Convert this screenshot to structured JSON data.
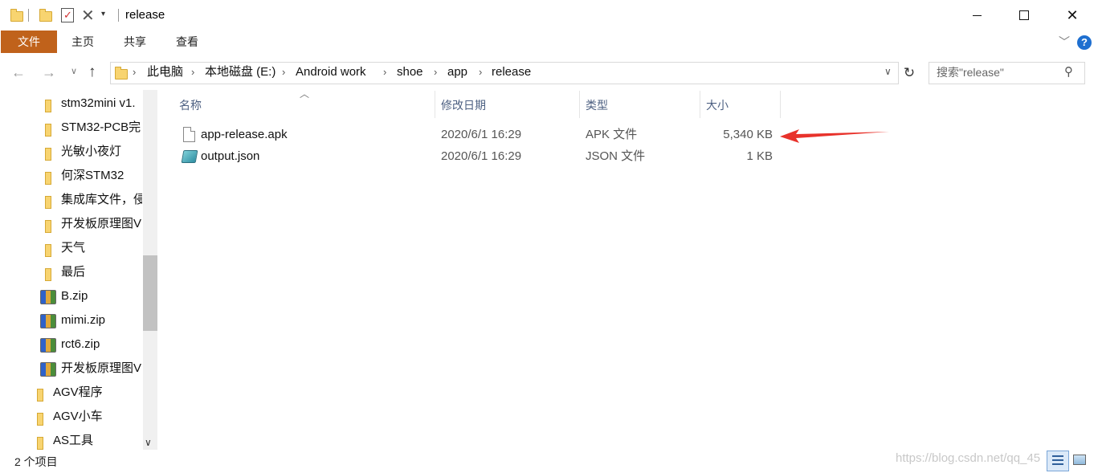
{
  "window": {
    "title": "release"
  },
  "ribbon": {
    "tabs": [
      "文件",
      "主页",
      "共享",
      "查看"
    ]
  },
  "address": {
    "breadcrumbs": [
      "此电脑",
      "本地磁盘 (E:)",
      "Android work",
      "shoe",
      "app",
      "release"
    ]
  },
  "search": {
    "placeholder": "搜索\"release\""
  },
  "nav": {
    "items": [
      {
        "label": "stm32mini v1.",
        "icon": "folder-icon"
      },
      {
        "label": "STM32-PCB完",
        "icon": "folder-icon"
      },
      {
        "label": "光敏小夜灯",
        "icon": "folder-icon"
      },
      {
        "label": "何深STM32",
        "icon": "folder-icon"
      },
      {
        "label": "集成库文件，侵",
        "icon": "folder-icon"
      },
      {
        "label": "开发板原理图V",
        "icon": "folder-icon"
      },
      {
        "label": "天气",
        "icon": "folder-icon"
      },
      {
        "label": "最后",
        "icon": "folder-icon"
      },
      {
        "label": "B.zip",
        "icon": "zip-icon"
      },
      {
        "label": "mimi.zip",
        "icon": "zip-icon"
      },
      {
        "label": "rct6.zip",
        "icon": "zip-icon"
      },
      {
        "label": "开发板原理图V",
        "icon": "zip-icon"
      },
      {
        "label": "AGV程序",
        "icon": "folder-icon"
      },
      {
        "label": "AGV小车",
        "icon": "folder-icon"
      },
      {
        "label": "AS工具",
        "icon": "folder-icon"
      }
    ]
  },
  "list": {
    "columns": [
      "名称",
      "修改日期",
      "类型",
      "大小"
    ],
    "rows": [
      {
        "name": "app-release.apk",
        "date": "2020/6/1 16:29",
        "type": "APK 文件",
        "size": "5,340 KB",
        "icon": "document-icon"
      },
      {
        "name": "output.json",
        "date": "2020/6/1 16:29",
        "type": "JSON 文件",
        "size": "1 KB",
        "icon": "json-file-icon"
      }
    ]
  },
  "status": {
    "count": "2 个项目"
  },
  "watermark": "https://blog.csdn.net/qq_45"
}
